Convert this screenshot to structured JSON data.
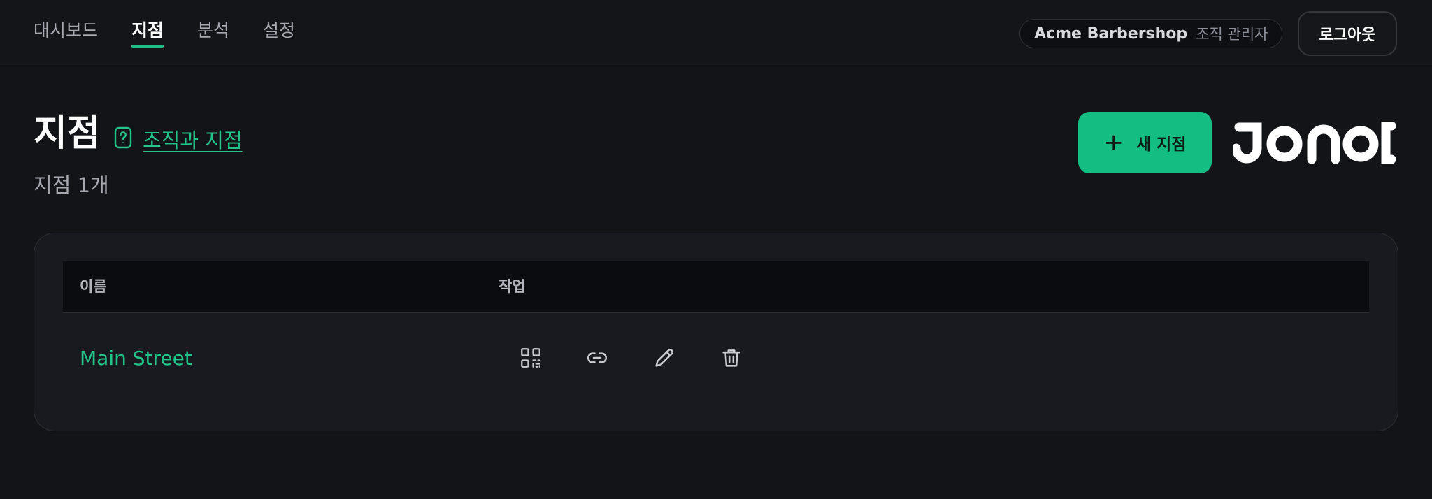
{
  "nav": {
    "items": [
      {
        "label": "대시보드",
        "active": false
      },
      {
        "label": "지점",
        "active": true
      },
      {
        "label": "분석",
        "active": false
      },
      {
        "label": "설정",
        "active": false
      }
    ]
  },
  "org": {
    "name": "Acme Barbershop",
    "role": "조직 관리자"
  },
  "header": {
    "logout_label": "로그아웃"
  },
  "page": {
    "title": "지점",
    "help_link": "조직과 지점",
    "count_text": "지점 1개",
    "new_button_label": "새 지점"
  },
  "brand": {
    "logo_text": "JONOT"
  },
  "table": {
    "columns": [
      "이름",
      "작업"
    ],
    "rows": [
      {
        "name": "Main Street",
        "actions": [
          "qr-code-icon",
          "link-icon",
          "pencil-icon",
          "trash-icon"
        ]
      }
    ]
  },
  "colors": {
    "accent": "#14bd82",
    "link": "#22c48a",
    "background": "#131418",
    "card": "#191a1f"
  }
}
